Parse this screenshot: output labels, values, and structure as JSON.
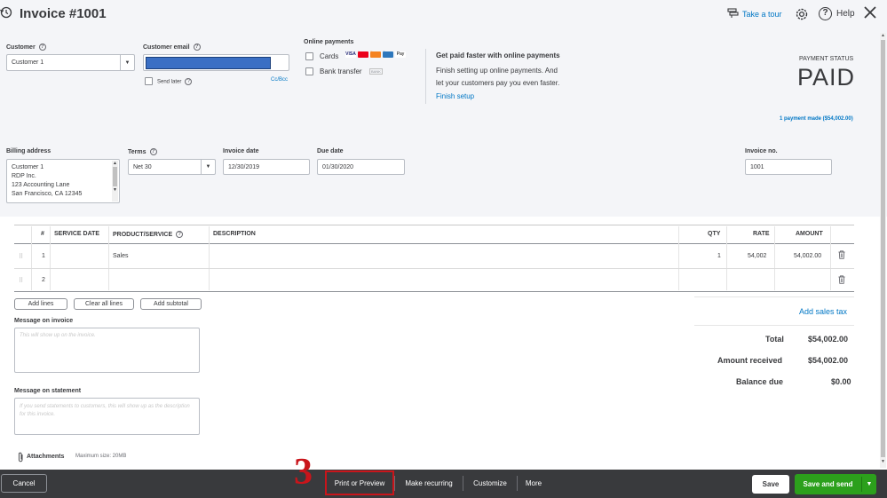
{
  "header": {
    "title": "Invoice #1001",
    "take_tour": "Take a tour",
    "help": "Help"
  },
  "customer": {
    "label": "Customer",
    "value": "Customer 1"
  },
  "email": {
    "label": "Customer email",
    "send_later": "Send later",
    "cc_bcc": "Cc/Bcc"
  },
  "online_payments": {
    "label": "Online payments",
    "cards": "Cards",
    "bank_transfer": "Bank transfer",
    "card_logos": [
      "VISA",
      "MC",
      "DISC",
      "AMEX",
      "Pay"
    ],
    "bank_logo": "BANK"
  },
  "promo": {
    "title": "Get paid faster with online payments",
    "line1": "Finish setting up online payments. And",
    "line2": "let your customers pay you even faster.",
    "link": "Finish setup"
  },
  "payment_status": {
    "label": "PAYMENT STATUS",
    "value": "PAID",
    "payments_made": "1 payment made ($54,002.00)"
  },
  "billing": {
    "label": "Billing address",
    "lines": [
      "Customer 1",
      "RDP Inc.",
      "123 Accounting Lane",
      "San Francisco, CA  12345"
    ]
  },
  "terms": {
    "label": "Terms",
    "value": "Net 30"
  },
  "invoice_date": {
    "label": "Invoice date",
    "value": "12/30/2019"
  },
  "due_date": {
    "label": "Due date",
    "value": "01/30/2020"
  },
  "invoice_no": {
    "label": "Invoice no.",
    "value": "1001"
  },
  "table": {
    "headers": {
      "num": "#",
      "service_date": "SERVICE DATE",
      "product": "PRODUCT/SERVICE",
      "description": "DESCRIPTION",
      "qty": "QTY",
      "rate": "RATE",
      "amount": "AMOUNT"
    },
    "rows": [
      {
        "num": "1",
        "service_date": "",
        "product": "Sales",
        "description": "",
        "qty": "1",
        "rate": "54,002",
        "amount": "54,002.00"
      },
      {
        "num": "2",
        "service_date": "",
        "product": "",
        "description": "",
        "qty": "",
        "rate": "",
        "amount": ""
      }
    ]
  },
  "line_buttons": {
    "add_lines": "Add lines",
    "clear_all": "Clear all lines",
    "add_subtotal": "Add subtotal"
  },
  "message_invoice": {
    "label": "Message on invoice",
    "placeholder": "This will show up on the invoice."
  },
  "message_statement": {
    "label": "Message on statement",
    "placeholder": "If you send statements to customers, this will show up as the description for this invoice."
  },
  "attachments": {
    "label": "Attachments",
    "max_size": "Maximum size: 20MB"
  },
  "totals": {
    "add_sales_tax": "Add sales tax",
    "total_label": "Total",
    "total_value": "$54,002.00",
    "received_label": "Amount received",
    "received_value": "$54,002.00",
    "balance_label": "Balance due",
    "balance_value": "$0.00"
  },
  "footer": {
    "cancel": "Cancel",
    "step_number": "3",
    "print_preview": "Print or Preview",
    "make_recurring": "Make recurring",
    "customize": "Customize",
    "more": "More",
    "save": "Save",
    "save_send": "Save and send"
  },
  "colors": {
    "accent_blue": "#0077c5",
    "primary_green": "#2ca01c",
    "footer_bg": "#393a3d",
    "highlight_red": "#c9151b",
    "redacted_blue": "#3a6fc4"
  }
}
